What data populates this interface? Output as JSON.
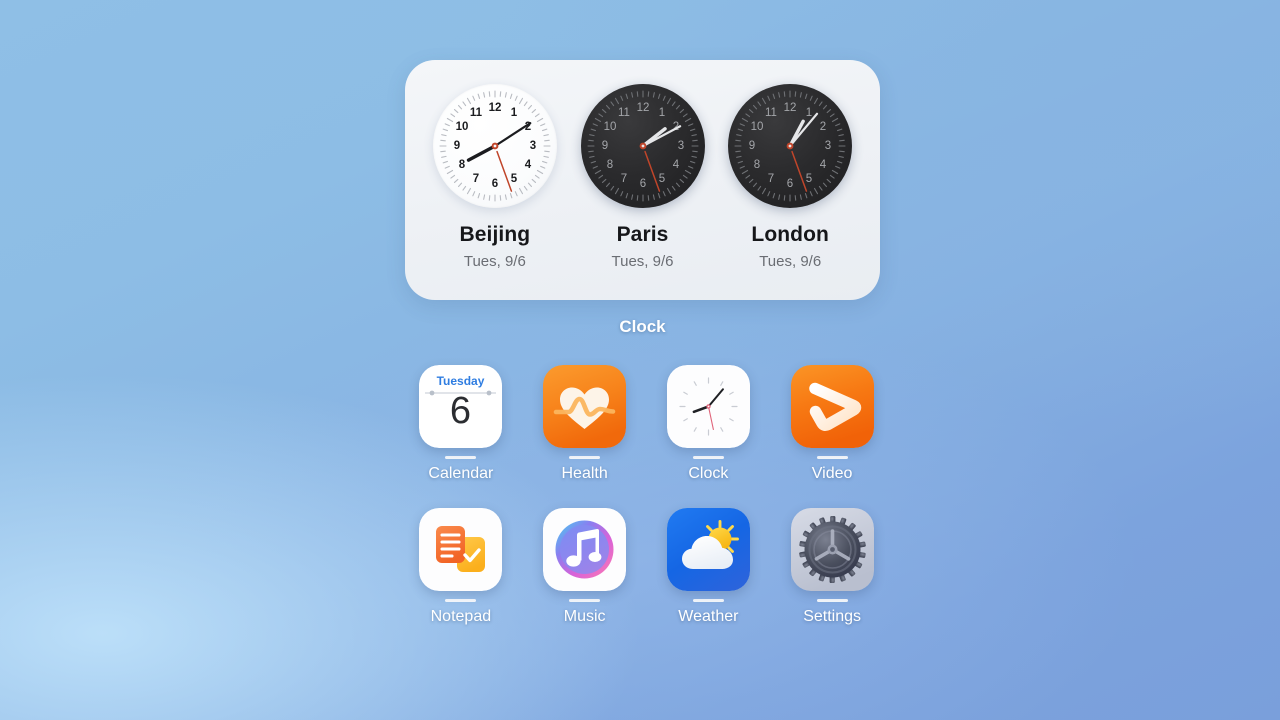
{
  "wallpaper": {
    "gradient_from": "#8fbfe6",
    "gradient_to": "#7a9fdb"
  },
  "widget": {
    "label": "Clock",
    "clocks": [
      {
        "city": "Beijing",
        "date": "Tues, 9/6",
        "theme": "light",
        "hour_deg": 242,
        "minute_deg": 57,
        "second_deg": 160
      },
      {
        "city": "Paris",
        "date": "Tues, 9/6",
        "theme": "dark",
        "hour_deg": 52,
        "minute_deg": 62,
        "second_deg": 160
      },
      {
        "city": "London",
        "date": "Tues, 9/6",
        "theme": "dark",
        "hour_deg": 28,
        "minute_deg": 40,
        "second_deg": 160
      }
    ],
    "hour_numbers": [
      "12",
      "1",
      "2",
      "3",
      "4",
      "5",
      "6",
      "7",
      "8",
      "9",
      "10",
      "11"
    ],
    "colors": {
      "card_background": "#f1f4f8",
      "light_face": "#ffffff",
      "dark_face": "#222224",
      "second_hand": "#c0452a",
      "city_text": "#16171a",
      "date_text": "#6a6d73"
    }
  },
  "apps": [
    {
      "name": "Calendar",
      "icon": "calendar-icon",
      "weekday": "Tuesday",
      "day": "6",
      "accent": "#2f7de1"
    },
    {
      "name": "Health",
      "icon": "health-icon",
      "accent": "#f5820a"
    },
    {
      "name": "Clock",
      "icon": "clock-icon",
      "accent": "#ffffff"
    },
    {
      "name": "Video",
      "icon": "video-icon",
      "accent": "#f5740c"
    },
    {
      "name": "Notepad",
      "icon": "notepad-icon",
      "accent": "#f4762f"
    },
    {
      "name": "Music",
      "icon": "music-icon",
      "accent": "#8b7ae8"
    },
    {
      "name": "Weather",
      "icon": "weather-icon",
      "accent": "#1464e0"
    },
    {
      "name": "Settings",
      "icon": "settings-icon",
      "accent": "#6f7480"
    }
  ]
}
